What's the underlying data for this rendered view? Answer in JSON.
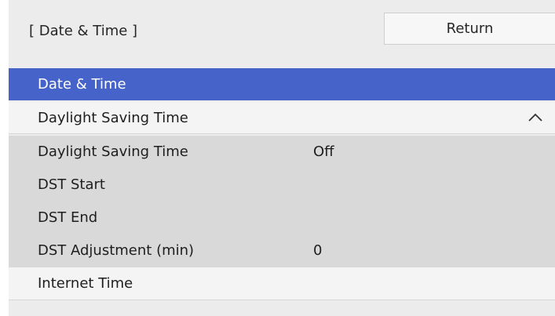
{
  "header": {
    "title": "[ Date & Time ]",
    "return_label": "Return"
  },
  "menu": {
    "selected": {
      "label": "Date & Time"
    },
    "group": {
      "label": "Daylight Saving Time",
      "icon": "chevron-up-icon"
    },
    "sub_items": [
      {
        "label": "Daylight Saving Time",
        "value": "Off"
      },
      {
        "label": "DST Start",
        "value": ""
      },
      {
        "label": "DST End",
        "value": ""
      },
      {
        "label": "DST Adjustment (min)",
        "value": "0"
      }
    ],
    "internet_time": {
      "label": "Internet Time"
    }
  },
  "colors": {
    "selected_bg": "#4663c9",
    "panel_bg": "#ececec",
    "sub_bg": "#d9d9d9"
  }
}
